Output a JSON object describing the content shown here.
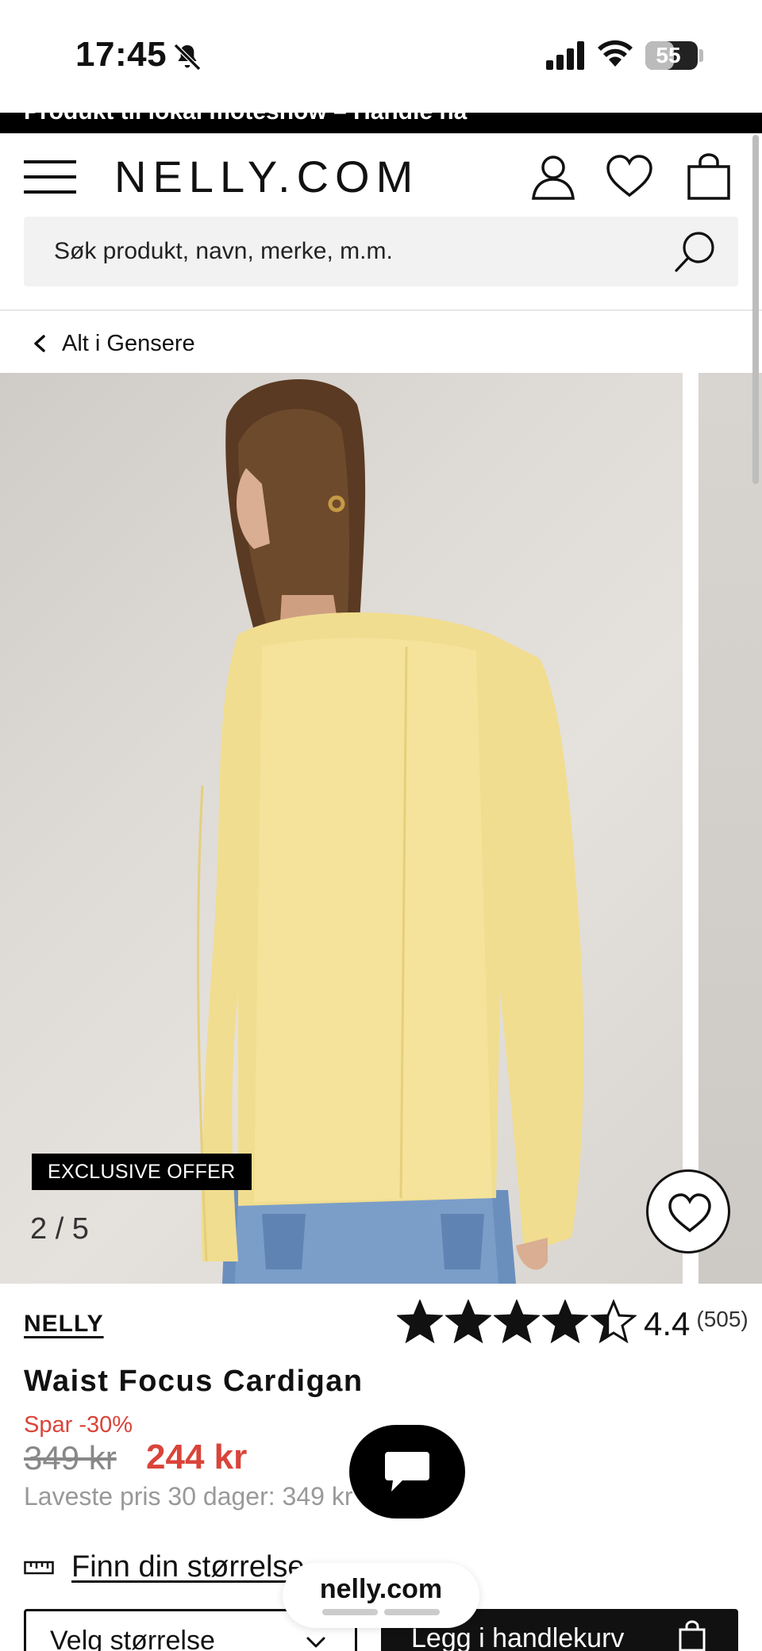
{
  "status_bar": {
    "time": "17:45",
    "battery": "55",
    "battery_level": 0.55
  },
  "promo": {
    "text": "Produkt til lokal moteshow – Handle nå"
  },
  "header": {
    "logo": "NELLY.COM",
    "search_placeholder": "Søk produkt, navn, merke, m.m."
  },
  "breadcrumb": {
    "label": "Alt i Gensere"
  },
  "gallery": {
    "badge": "EXCLUSIVE OFFER",
    "counter": "2 / 5"
  },
  "product": {
    "brand": "NELLY",
    "rating": {
      "value": "4.4",
      "count": "(505)",
      "stars": 4.4
    },
    "title": "Waist Focus Cardigan",
    "discount": "Spar -30%",
    "old_price": "349 kr",
    "price": "244 kr",
    "lowest_price": "Laveste pris 30 dager: 349 kr"
  },
  "actions": {
    "size_guide": "Finn din størrelse",
    "size_select": "Velg størrelse",
    "add_to_cart": "Legg i handlekurv"
  },
  "browser": {
    "url": "nelly.com"
  },
  "colors": {
    "accent_red": "#d9443a",
    "black": "#111111",
    "search_bg": "#f2f2f2"
  }
}
